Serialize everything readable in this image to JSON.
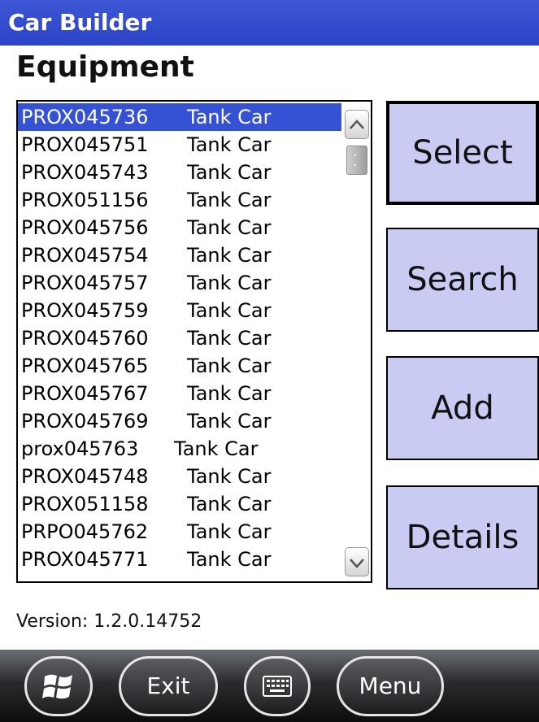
{
  "app": {
    "title": "Car Builder"
  },
  "page": {
    "heading": "Equipment"
  },
  "equipment_list": {
    "items": [
      {
        "id": "PROX045736",
        "type": "Tank Car",
        "selected": true
      },
      {
        "id": "PROX045751",
        "type": "Tank Car"
      },
      {
        "id": "PROX045743",
        "type": "Tank Car"
      },
      {
        "id": "PROX051156",
        "type": "Tank Car"
      },
      {
        "id": "PROX045756",
        "type": "Tank Car"
      },
      {
        "id": "PROX045754",
        "type": "Tank Car"
      },
      {
        "id": "PROX045757",
        "type": "Tank Car"
      },
      {
        "id": "PROX045759",
        "type": "Tank Car"
      },
      {
        "id": "PROX045760",
        "type": "Tank Car"
      },
      {
        "id": "PROX045765",
        "type": "Tank Car"
      },
      {
        "id": "PROX045767",
        "type": "Tank Car"
      },
      {
        "id": "PROX045769",
        "type": "Tank Car"
      },
      {
        "id": "prox045763",
        "type": "Tank Car"
      },
      {
        "id": "PROX045748",
        "type": "Tank Car"
      },
      {
        "id": "PROX051158",
        "type": "Tank Car"
      },
      {
        "id": "PRPO045762",
        "type": "Tank Car"
      },
      {
        "id": "PROX045771",
        "type": "Tank Car"
      }
    ]
  },
  "actions": {
    "select_label": "Select",
    "search_label": "Search",
    "add_label": "Add",
    "details_label": "Details"
  },
  "footer": {
    "version": "Version: 1.2.0.14752"
  },
  "taskbar": {
    "start_icon": "windows-logo-icon",
    "exit_label": "Exit",
    "keyboard_icon": "keyboard-icon",
    "menu_label": "Menu"
  },
  "colors": {
    "title_bar": "#2b43c6",
    "selection": "#3552d4",
    "action_button": "#cacbf2"
  }
}
